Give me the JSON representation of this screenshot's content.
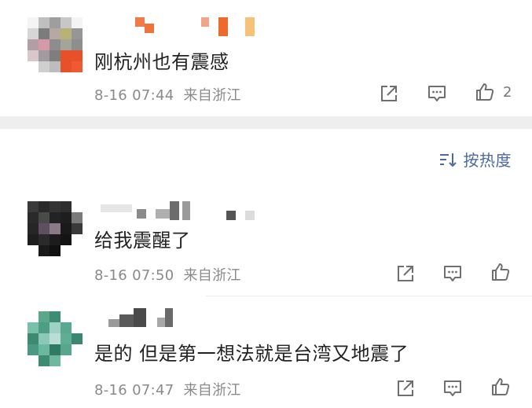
{
  "comments": [
    {
      "text": "刚杭州也有震感",
      "date": "8-16 07:44",
      "source": "来自浙江",
      "likes": "2",
      "colors": {
        "avatar_accent": "#e8502a"
      }
    },
    {
      "text": "给我震醒了",
      "date": "8-16 07:50",
      "source": "来自浙江",
      "likes": ""
    },
    {
      "text": "是的 但是第一想法就是台湾又地震了",
      "date": "8-16 07:47",
      "source": "来自浙江",
      "likes": ""
    }
  ],
  "sort": {
    "label": "按热度",
    "icon": "sort-icon"
  },
  "icons": {
    "share": "share-icon",
    "comment": "comment-icon",
    "like": "thumbs-up-icon"
  },
  "colors": {
    "sort_blue": "#4a6aa0",
    "meta_gray": "#8a8a8a",
    "icon_gray": "#6f6f6f",
    "band": "#eeeeee"
  }
}
